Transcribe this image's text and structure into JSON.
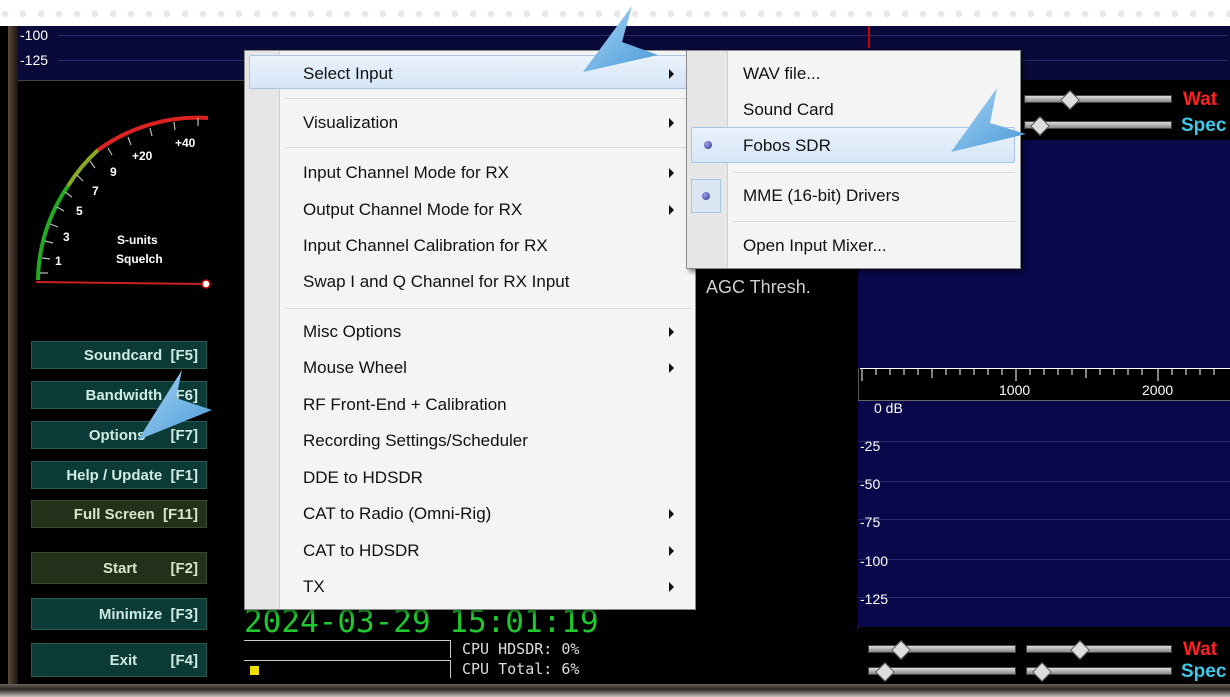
{
  "top_scale": {
    "labels": [
      "-100",
      "-125"
    ]
  },
  "meter": {
    "scale_labels": [
      "+40",
      "+20",
      "9",
      "7",
      "5",
      "3",
      "1"
    ],
    "title_1": "S-units",
    "title_2": "Squelch"
  },
  "left_buttons": [
    {
      "label": "Soundcard  [F5]"
    },
    {
      "label": "Bandwidth  [F6]"
    },
    {
      "label": "Options      [F7]"
    },
    {
      "label": "Help / Update  [F1]"
    },
    {
      "label": "Full Screen  [F11]"
    },
    {
      "label": "Start        [F2]"
    },
    {
      "label": "Minimize  [F3]"
    },
    {
      "label": "Exit        [F4]"
    }
  ],
  "options_menu": {
    "items": [
      {
        "label": "Select Input"
      },
      {
        "label": "Visualization"
      },
      {
        "label": "Input Channel Mode for RX"
      },
      {
        "label": "Output Channel Mode for RX"
      },
      {
        "label": "Input Channel Calibration for RX"
      },
      {
        "label": "Swap I and Q Channel for RX Input"
      },
      {
        "label": "Misc Options"
      },
      {
        "label": "Mouse Wheel"
      },
      {
        "label": "RF Front-End + Calibration"
      },
      {
        "label": "Recording Settings/Scheduler"
      },
      {
        "label": "DDE to HDSDR"
      },
      {
        "label": "CAT to Radio (Omni-Rig)"
      },
      {
        "label": "CAT to HDSDR"
      },
      {
        "label": "TX"
      }
    ]
  },
  "input_submenu": {
    "items": [
      {
        "label": "WAV file..."
      },
      {
        "label": "Sound Card"
      },
      {
        "label": "Fobos SDR"
      },
      {
        "label": "MME  (16-bit) Drivers"
      },
      {
        "label": "Open Input Mixer..."
      }
    ]
  },
  "agc_label": "AGC Thresh.",
  "right_panel": {
    "freq_axis": [
      "1000",
      "2000"
    ],
    "db_labels": [
      "0 dB",
      "-25",
      "-50",
      "-75",
      "-100",
      "-125"
    ],
    "label_wat": "Wat",
    "label_spec": "Spec"
  },
  "status": {
    "datetime": "2024-03-29 15:01:19",
    "cpu_hdsdr": "CPU HDSDR:  0%",
    "cpu_total": "CPU Total:  6%"
  },
  "colors": {
    "callout": "#6fb4e4",
    "button_bg": "#0c3a36",
    "clock": "#1ec82e"
  }
}
